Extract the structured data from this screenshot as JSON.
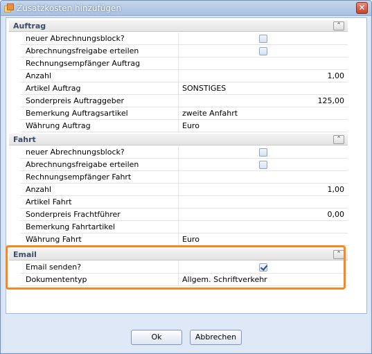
{
  "window": {
    "title": "Zusatzkosten hinzufügen",
    "close_glyph": "✕"
  },
  "groups": [
    {
      "title": "Auftrag",
      "toggle_glyph": "⌃",
      "rows": [
        {
          "label": "neuer Abrechnungsblock?",
          "type": "checkbox",
          "checked": false
        },
        {
          "label": "Abrechnungsfreigabe erteilen",
          "type": "checkbox",
          "checked": false
        },
        {
          "label": "Rechnungsempfänger Auftrag",
          "type": "text",
          "value": ""
        },
        {
          "label": "Anzahl",
          "type": "number",
          "value": "1,00"
        },
        {
          "label": "Artikel Auftrag",
          "type": "text",
          "value": "SONSTIGES"
        },
        {
          "label": "Sonderpreis Auftraggeber",
          "type": "number",
          "value": "125,00"
        },
        {
          "label": "Bemerkung Auftragsartikel",
          "type": "text",
          "value": "zweite Anfahrt"
        },
        {
          "label": "Währung Auftrag",
          "type": "text",
          "value": "Euro"
        }
      ]
    },
    {
      "title": "Fahrt",
      "toggle_glyph": "⌃",
      "rows": [
        {
          "label": "neuer Abrechnungsblock?",
          "type": "checkbox",
          "checked": false
        },
        {
          "label": "Abrechnungsfreigabe erteilen",
          "type": "checkbox",
          "checked": false
        },
        {
          "label": "Rechnungsempfänger Fahrt",
          "type": "text",
          "value": ""
        },
        {
          "label": "Anzahl",
          "type": "number",
          "value": "1,00"
        },
        {
          "label": "Artikel Fahrt",
          "type": "text",
          "value": ""
        },
        {
          "label": "Sonderpreis Frachtführer",
          "type": "number",
          "value": "0,00"
        },
        {
          "label": "Bemerkung Fahrtartikel",
          "type": "text",
          "value": ""
        },
        {
          "label": "Währung Fahrt",
          "type": "text",
          "value": "Euro"
        }
      ]
    },
    {
      "title": "Email",
      "toggle_glyph": "⌃",
      "rows": [
        {
          "label": "Email senden?",
          "type": "checkbox",
          "checked": true
        },
        {
          "label": "Dokumententyp",
          "type": "text",
          "value": "Allgem. Schriftverkehr"
        }
      ]
    }
  ],
  "buttons": {
    "ok_label": "Ok",
    "cancel_label": "Abbrechen"
  },
  "colors": {
    "highlight": "#f5891f",
    "titlebar": "#a9c1e1",
    "group_title": "#3b4c66"
  }
}
